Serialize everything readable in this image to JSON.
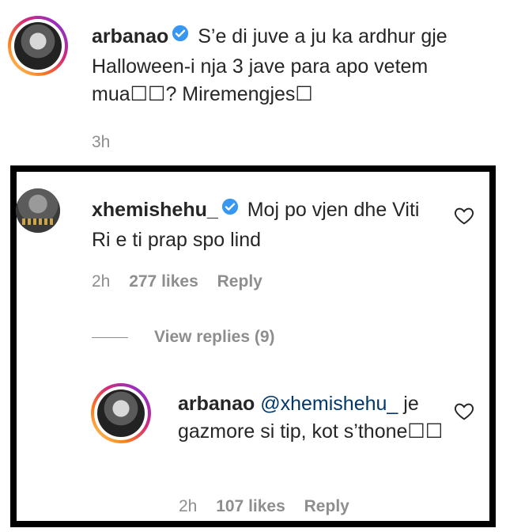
{
  "main_comment": {
    "username": "arbanao",
    "text": " S’e di juve a ju ka ardhur gje Halloween-i nja 3 jave para apo vetem mua☐☐? Miremengjes☐",
    "time": "3h"
  },
  "reply_one": {
    "username": "xhemishehu_",
    "text": " Moj po vjen dhe Viti Ri e ti prap spo lind",
    "time": "2h",
    "likes": "277 likes",
    "reply_label": "Reply"
  },
  "view_replies": "View replies (9)",
  "reply_two": {
    "username": "arbanao",
    "mention": "@xhemishehu_",
    "text": " je gazmore si tip, kot s’thone☐☐",
    "time": "2h",
    "likes": "107 likes",
    "reply_label": "Reply"
  },
  "colors": {
    "verified": "#3897f0",
    "mention": "#00376b",
    "meta": "#8e8e8e",
    "border": "#000000"
  },
  "icons": [
    "verified-badge-icon",
    "heart-icon"
  ]
}
